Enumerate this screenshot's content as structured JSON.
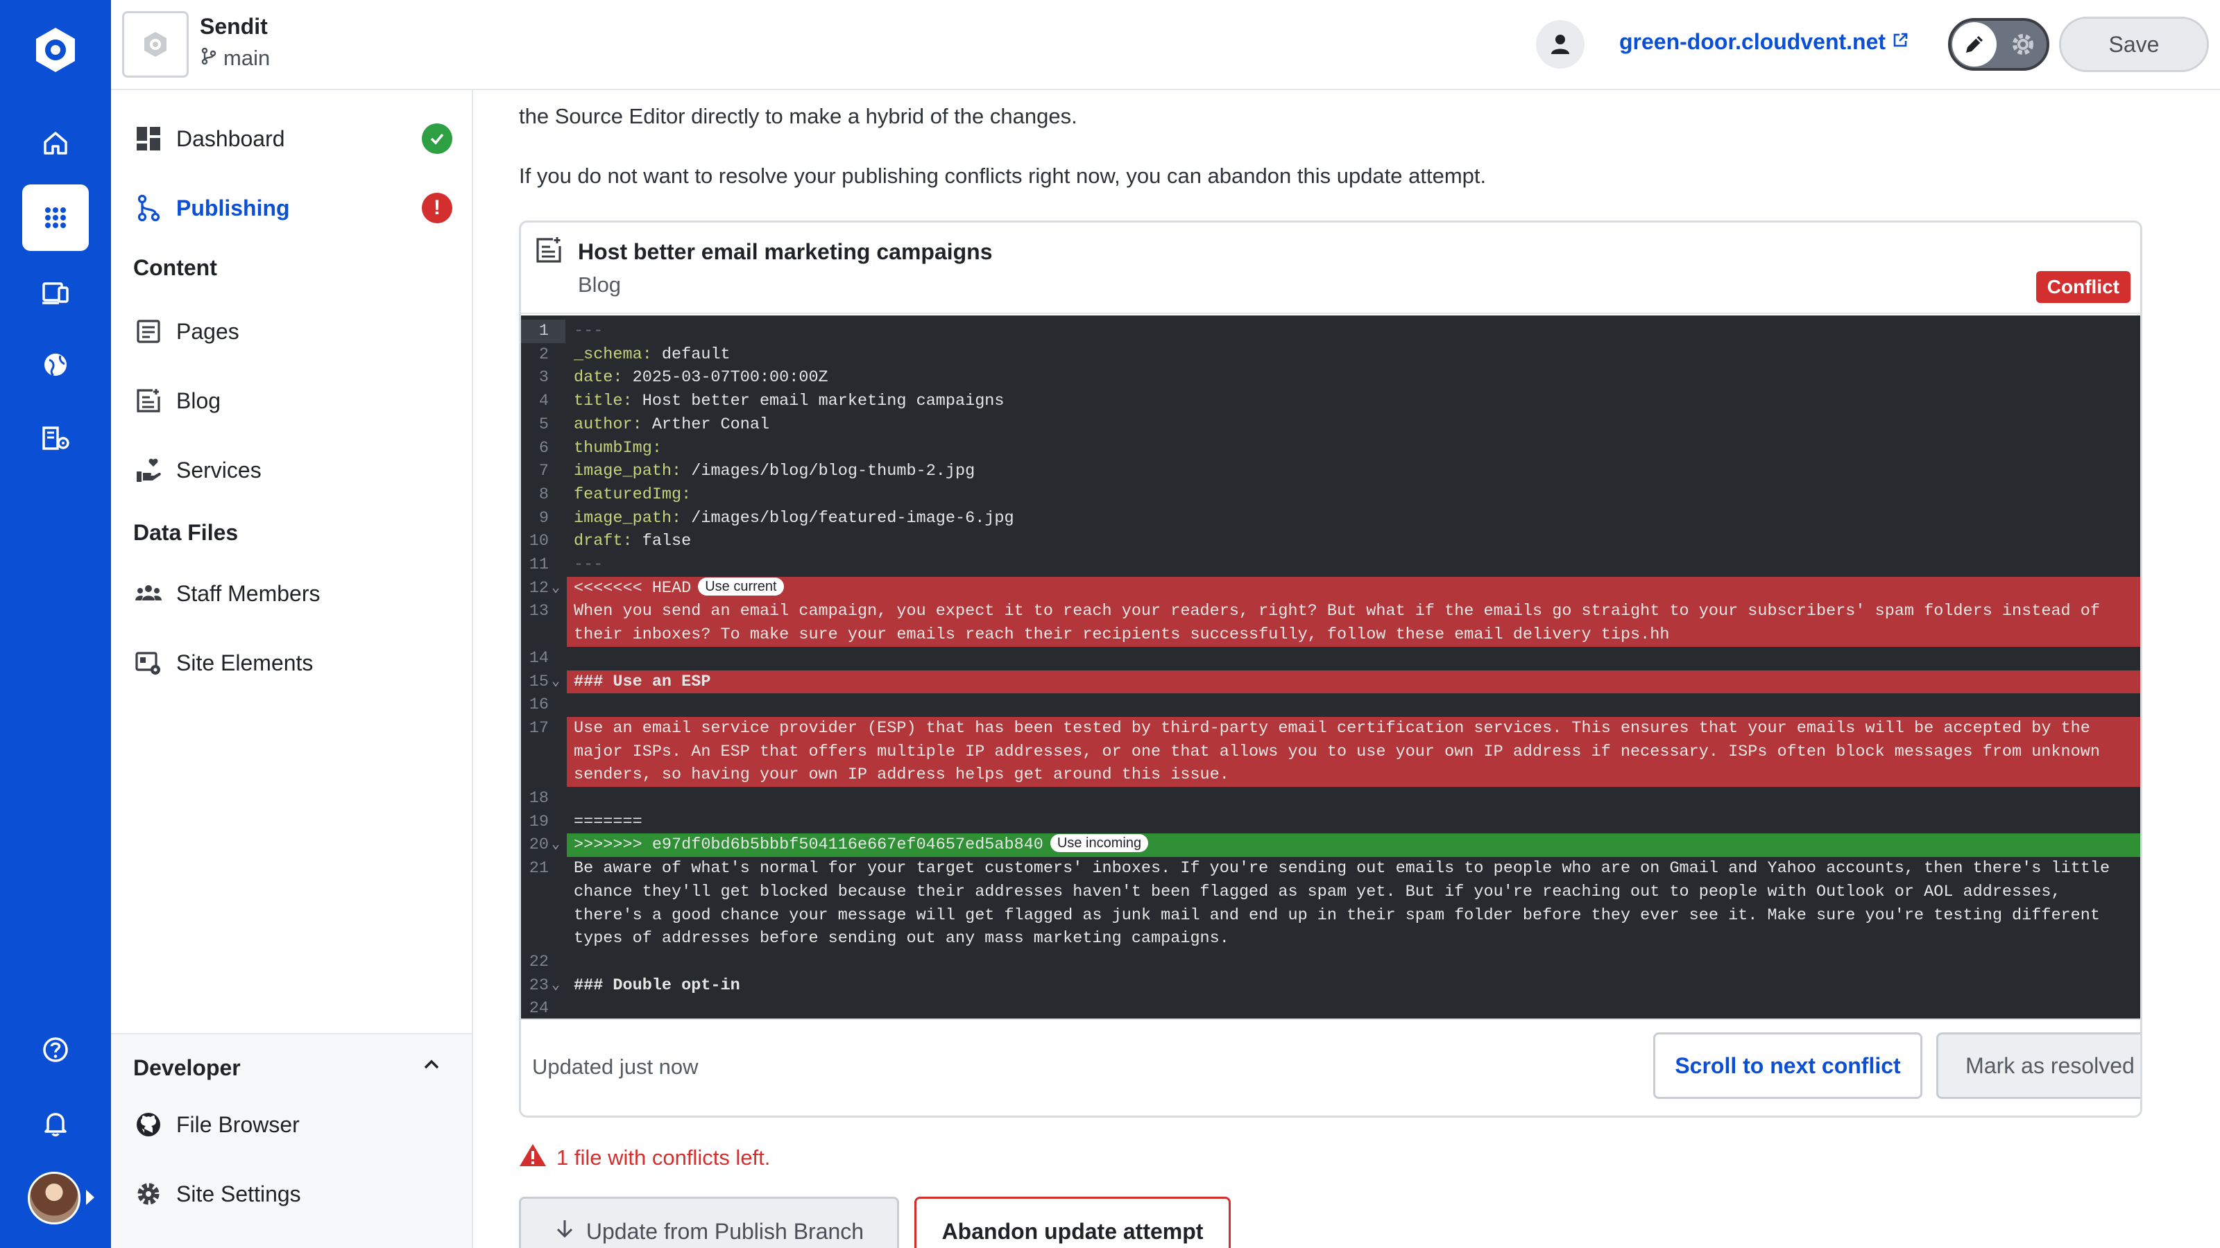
{
  "app": {
    "site_name": "Sendit",
    "branch": "main",
    "site_url": "green-door.cloudvent.net",
    "save_label": "Save"
  },
  "colors": {
    "brand": "#0a4fd4",
    "conflict_red": "#d32f2f",
    "current_band": "#b3373a",
    "incoming_band": "#2f8f34",
    "editor_bg": "#272b2f",
    "success_green": "#2ea043"
  },
  "rail": {
    "icons": [
      "home-icon",
      "apps-grid-icon",
      "devices-icon",
      "globe-icon",
      "domain-settings-icon",
      "help-icon",
      "bell-icon"
    ]
  },
  "nav": {
    "dashboard": "Dashboard",
    "publishing": "Publishing",
    "content_heading": "Content",
    "pages": "Pages",
    "blog": "Blog",
    "services": "Services",
    "data_files_heading": "Data Files",
    "staff_members": "Staff Members",
    "site_elements": "Site Elements",
    "developer_heading": "Developer",
    "file_browser": "File Browser",
    "site_settings": "Site Settings"
  },
  "main": {
    "para_top": "the Source Editor directly to make a hybrid of the changes.",
    "para_abandon": "If you do not want to resolve your publishing conflicts right now, you can abandon this update attempt.",
    "file": {
      "title": "Host better email marketing campaigns",
      "collection": "Blog",
      "badge": "Conflict",
      "updated": "Updated just now",
      "scroll_label": "Scroll to next conflict",
      "resolve_label": "Mark as resolved"
    },
    "conflicts_left": "1 file with conflicts left.",
    "update_label": "Update from Publish Branch",
    "abandon_label": "Abandon update attempt"
  },
  "editor": {
    "use_current": "Use current",
    "use_incoming": "Use incoming",
    "lines": [
      {
        "n": "1",
        "text": "---"
      },
      {
        "n": "2",
        "key": "_schema:",
        "val": " default"
      },
      {
        "n": "3",
        "key": "date:",
        "val": " 2025-03-07T00:00:00Z"
      },
      {
        "n": "4",
        "key": "title:",
        "val": " Host better email marketing campaigns"
      },
      {
        "n": "5",
        "key": "author:",
        "val": " Arther Conal"
      },
      {
        "n": "6",
        "key": "thumbImg:",
        "val": ""
      },
      {
        "n": "7",
        "key": "image_path:",
        "val": " /images/blog/blog-thumb-2.jpg"
      },
      {
        "n": "8",
        "key": "featuredImg:",
        "val": ""
      },
      {
        "n": "9",
        "key": "image_path:",
        "val": " /images/blog/featured-image-6.jpg"
      },
      {
        "n": "10",
        "key": "draft:",
        "val": " false"
      },
      {
        "n": "11",
        "text": "---"
      },
      {
        "n": "12",
        "text": "<<<<<<< HEAD"
      },
      {
        "n": "13",
        "text": "When you send an email campaign, you expect it to reach your readers, right? But what if the emails go straight to your subscribers' spam folders instead of their inboxes? To make sure your emails reach their recipients successfully, follow these email delivery tips.hh"
      },
      {
        "n": "14",
        "text": ""
      },
      {
        "n": "15",
        "text": "### Use an ESP"
      },
      {
        "n": "16",
        "text": ""
      },
      {
        "n": "17",
        "text": "Use an email service provider (ESP) that has been tested by third-party email certification services. This ensures that your emails will be accepted by the major ISPs. An ESP that offers multiple IP addresses, or one that allows you to use your own IP address if necessary. ISPs often block messages from unknown senders, so having your own IP address helps get around this issue."
      },
      {
        "n": "18",
        "text": ""
      },
      {
        "n": "19",
        "text": "======="
      },
      {
        "n": "20",
        "text": ">>>>>>> e97df0bd6b5bbbf504116e667ef04657ed5ab840"
      },
      {
        "n": "21",
        "text": "Be aware of what's normal for your target customers' inboxes. If you're sending out emails to people who are on Gmail and Yahoo accounts, then there's little chance they'll get blocked because their addresses haven't been flagged as spam yet. But if you're reaching out to people with Outlook or AOL addresses, there's a good chance your message will get flagged as junk mail and end up in their spam folder before they ever see it. Make sure you're testing different types of addresses before sending out any mass marketing campaigns."
      },
      {
        "n": "22",
        "text": ""
      },
      {
        "n": "23",
        "text": "### Double opt-in"
      },
      {
        "n": "24",
        "text": ""
      }
    ]
  }
}
